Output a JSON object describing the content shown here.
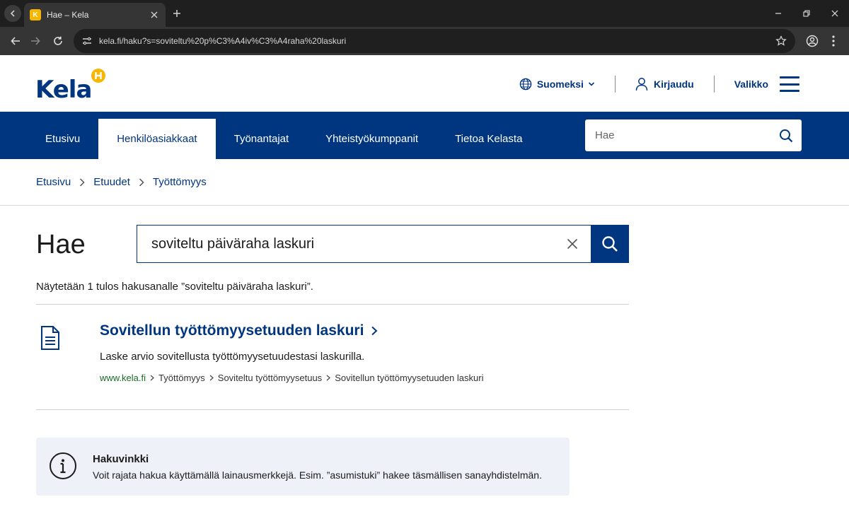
{
  "browser": {
    "tab_title": "Hae – Kela",
    "url": "kela.fi/haku?s=soviteltu%20p%C3%A4iv%C3%A4raha%20laskuri"
  },
  "header": {
    "logo_text": "Kela",
    "language_label": "Suomeksi",
    "login_label": "Kirjaudu",
    "menu_label": "Valikko"
  },
  "nav": {
    "items": [
      {
        "label": "Etusivu",
        "active": false
      },
      {
        "label": "Henkilöasiakkaat",
        "active": true
      },
      {
        "label": "Työnantajat",
        "active": false
      },
      {
        "label": "Yhteistyökumppanit",
        "active": false
      },
      {
        "label": "Tietoa Kelasta",
        "active": false
      }
    ],
    "search_placeholder": "Hae"
  },
  "breadcrumb": [
    "Etusivu",
    "Etuudet",
    "Työttömyys"
  ],
  "search": {
    "heading": "Hae",
    "query": "soviteltu päiväraha laskuri",
    "result_count_text": "Näytetään 1 tulos hakusanalle ”soviteltu päiväraha laskuri”."
  },
  "results": [
    {
      "title": "Sovitellun työttömyysetuuden laskuri",
      "description": "Laske arvio sovitellusta työttömyysetuudestasi laskurilla.",
      "domain": "www.kela.fi",
      "path": [
        "Työttömyys",
        "Soviteltu työttömyysetuus",
        "Sovitellun työttömyysetuuden laskuri"
      ]
    }
  ],
  "tip": {
    "title": "Hakuvinkki",
    "text": "Voit rajata hakua käyttämällä lainausmerkkejä. Esim. ”asumistuki” hakee täsmällisen sanayhdistelmän."
  },
  "colors": {
    "brand_blue": "#003580",
    "brand_yellow": "#f5b700",
    "tip_background": "#eef1f8",
    "domain_green": "#1a6b2a"
  }
}
